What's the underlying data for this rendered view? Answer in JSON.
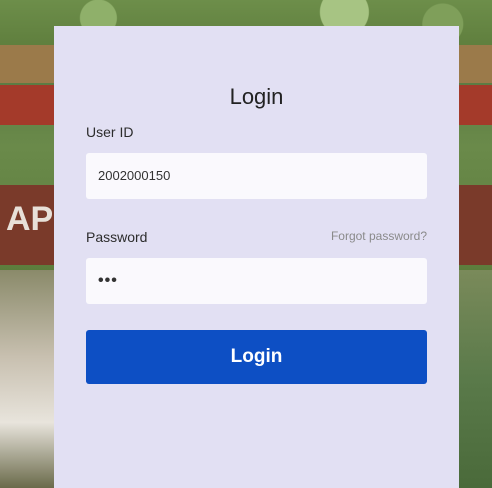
{
  "login_form": {
    "title": "Login",
    "user_id_label": "User ID",
    "user_id_value": "2002000150",
    "password_label": "Password",
    "forgot_password_label": "Forgot password?",
    "password_value": "•••",
    "login_button_label": "Login"
  },
  "background": {
    "sign_text": "AP"
  },
  "colors": {
    "panel_background": "#e2e0f3",
    "button_background": "#0d4fc4",
    "button_text": "#ffffff"
  }
}
